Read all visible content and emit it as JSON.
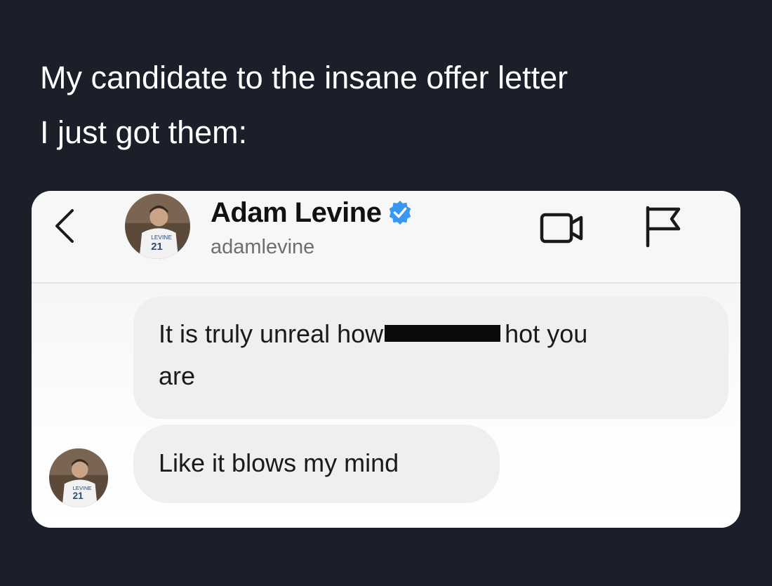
{
  "caption": {
    "line1": "My candidate to the insane offer letter",
    "line2": "I just got them:"
  },
  "dm_header": {
    "name": "Adam Levine",
    "handle": "adamlevine",
    "icons": [
      "back-chevron-icon",
      "avatar",
      "verified-badge-icon",
      "video-call-icon",
      "flag-icon"
    ]
  },
  "messages": [
    {
      "before_redaction": "It is truly unreal how",
      "after_redaction": "hot you",
      "continuation": "are",
      "redacted": true
    },
    {
      "text": "Like it blows my mind"
    }
  ],
  "colors": {
    "page_background": "#1b1f2a",
    "caption_text": "#ffffff",
    "bubble_background": "#efefef",
    "verified_blue": "#3897f0",
    "redaction_bar": "#0a0a0a"
  }
}
